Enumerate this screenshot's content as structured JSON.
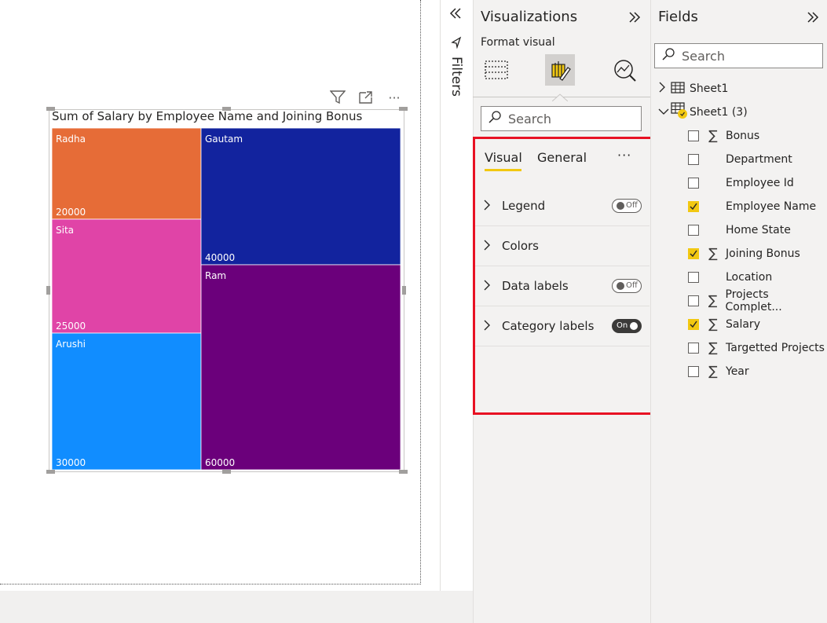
{
  "visual": {
    "title": "Sum of Salary by Employee Name and Joining Bonus",
    "more_label": "···"
  },
  "chart_data": {
    "type": "treemap",
    "title": "Sum of Salary by Employee Name and Joining Bonus",
    "tiles": [
      {
        "name": "Radha",
        "value": 20000,
        "color": "#e66c37"
      },
      {
        "name": "Sita",
        "value": 25000,
        "color": "#e044a7"
      },
      {
        "name": "Arushi",
        "value": 30000,
        "color": "#118dff"
      },
      {
        "name": "Gautam",
        "value": 40000,
        "color": "#12239e"
      },
      {
        "name": "Ram",
        "value": 60000,
        "color": "#6b007b"
      }
    ]
  },
  "filters": {
    "label": "Filters"
  },
  "visualizations": {
    "title": "Visualizations",
    "subtitle": "Format visual",
    "search_placeholder": "Search",
    "tabs": {
      "visual": "Visual",
      "general": "General",
      "more": "···"
    },
    "sections": [
      {
        "label": "Legend",
        "toggle": "Off"
      },
      {
        "label": "Colors",
        "toggle": null
      },
      {
        "label": "Data labels",
        "toggle": "Off"
      },
      {
        "label": "Category labels",
        "toggle": "On"
      }
    ]
  },
  "fields": {
    "title": "Fields",
    "search_placeholder": "Search",
    "tables": [
      {
        "label": "Sheet1",
        "expanded": false
      },
      {
        "label": "Sheet1 (3)",
        "expanded": true
      }
    ],
    "items": [
      {
        "label": "Bonus",
        "checked": false,
        "sigma": true
      },
      {
        "label": "Department",
        "checked": false,
        "sigma": false
      },
      {
        "label": "Employee Id",
        "checked": false,
        "sigma": false
      },
      {
        "label": "Employee Name",
        "checked": true,
        "sigma": false
      },
      {
        "label": "Home State",
        "checked": false,
        "sigma": false
      },
      {
        "label": "Joining Bonus",
        "checked": true,
        "sigma": true
      },
      {
        "label": "Location",
        "checked": false,
        "sigma": false
      },
      {
        "label": "Projects Complet...",
        "checked": false,
        "sigma": true
      },
      {
        "label": "Salary",
        "checked": true,
        "sigma": true
      },
      {
        "label": "Targetted Projects",
        "checked": false,
        "sigma": true
      },
      {
        "label": "Year",
        "checked": false,
        "sigma": true
      }
    ]
  },
  "colors": {
    "accent": "#f2c811",
    "highlight_box": "#e81123"
  }
}
